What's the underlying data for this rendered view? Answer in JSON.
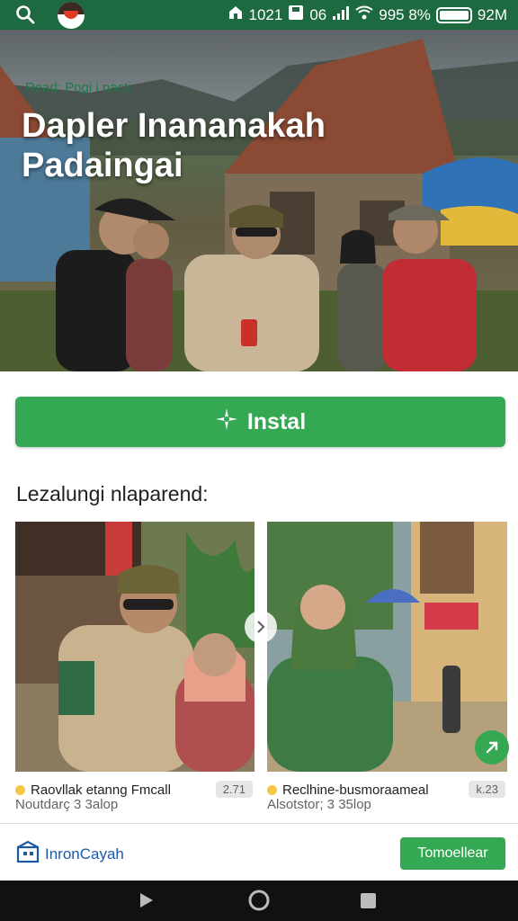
{
  "status_bar": {
    "icons": [
      "search-icon",
      "app-logo",
      "home-icon",
      "save-icon",
      "signal-icon",
      "wifi-icon",
      "battery-icon"
    ],
    "time": "1021",
    "notif": "06",
    "battery_text": "995 8%",
    "network": "92M"
  },
  "hero": {
    "tag": "Read: Pogi i nacti",
    "title_line1": "Dapler Inananakah",
    "title_line2": "Padaingai"
  },
  "install": {
    "label": "Instal",
    "icon": "sparkle-icon"
  },
  "section": {
    "title": "Lezalungi nlaparend:"
  },
  "cards": [
    {
      "title": "Raovllak etanng Fmcall",
      "subtitle": "Noutdarç 3 3alop",
      "badge": "2.71"
    },
    {
      "title": "Reclhine-busmoraameal",
      "subtitle": "Alsotstor; 3 35lop",
      "badge": "k.23"
    }
  ],
  "bottom": {
    "brand": "InronCayah",
    "cta": "Tomoellear"
  },
  "colors": {
    "brand_green": "#34a853",
    "status_green": "#1e6a40",
    "brand_blue": "#1a5aa8"
  }
}
